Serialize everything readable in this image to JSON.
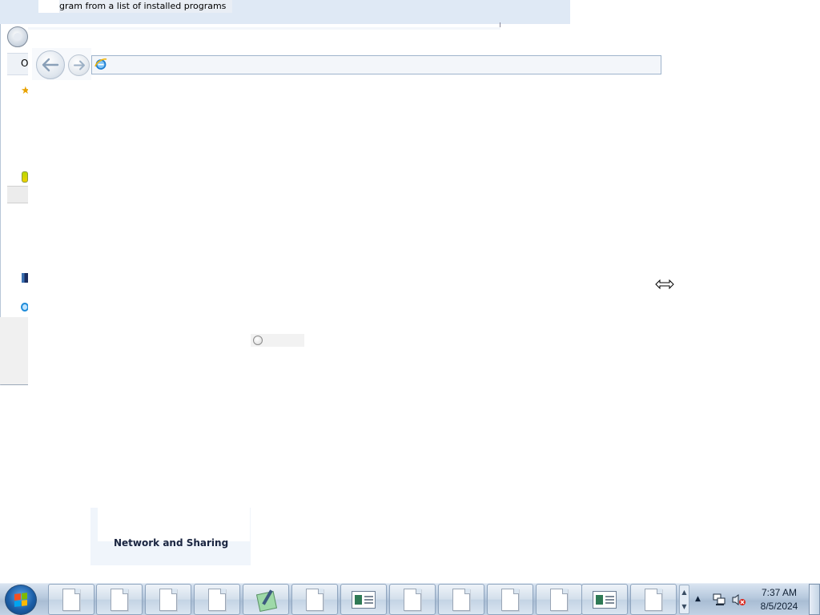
{
  "background_window": {
    "title": "gram from a list of installed programs",
    "menu_initial": "O"
  },
  "tile": {
    "label": "Network and Sharing"
  },
  "taskbar": {
    "buttons": [
      {
        "icon": "document-icon"
      },
      {
        "icon": "document-icon"
      },
      {
        "icon": "document-icon"
      },
      {
        "icon": "document-icon"
      },
      {
        "icon": "notepad-icon"
      },
      {
        "icon": "document-icon"
      },
      {
        "icon": "window-icon"
      },
      {
        "icon": "document-icon"
      },
      {
        "icon": "document-icon"
      },
      {
        "icon": "document-icon"
      },
      {
        "icon": "document-icon"
      },
      {
        "icon": "window-icon"
      },
      {
        "icon": "document-icon"
      }
    ],
    "scroll_up": "▲",
    "scroll_down": "▼"
  },
  "tray": {
    "chevron": "▲",
    "time": "7:37 AM",
    "date": "8/5/2024"
  },
  "colors": {
    "accent": "#1f8cd9",
    "taskbar": "#b6c8dd",
    "sound_error": "#d9261c"
  }
}
